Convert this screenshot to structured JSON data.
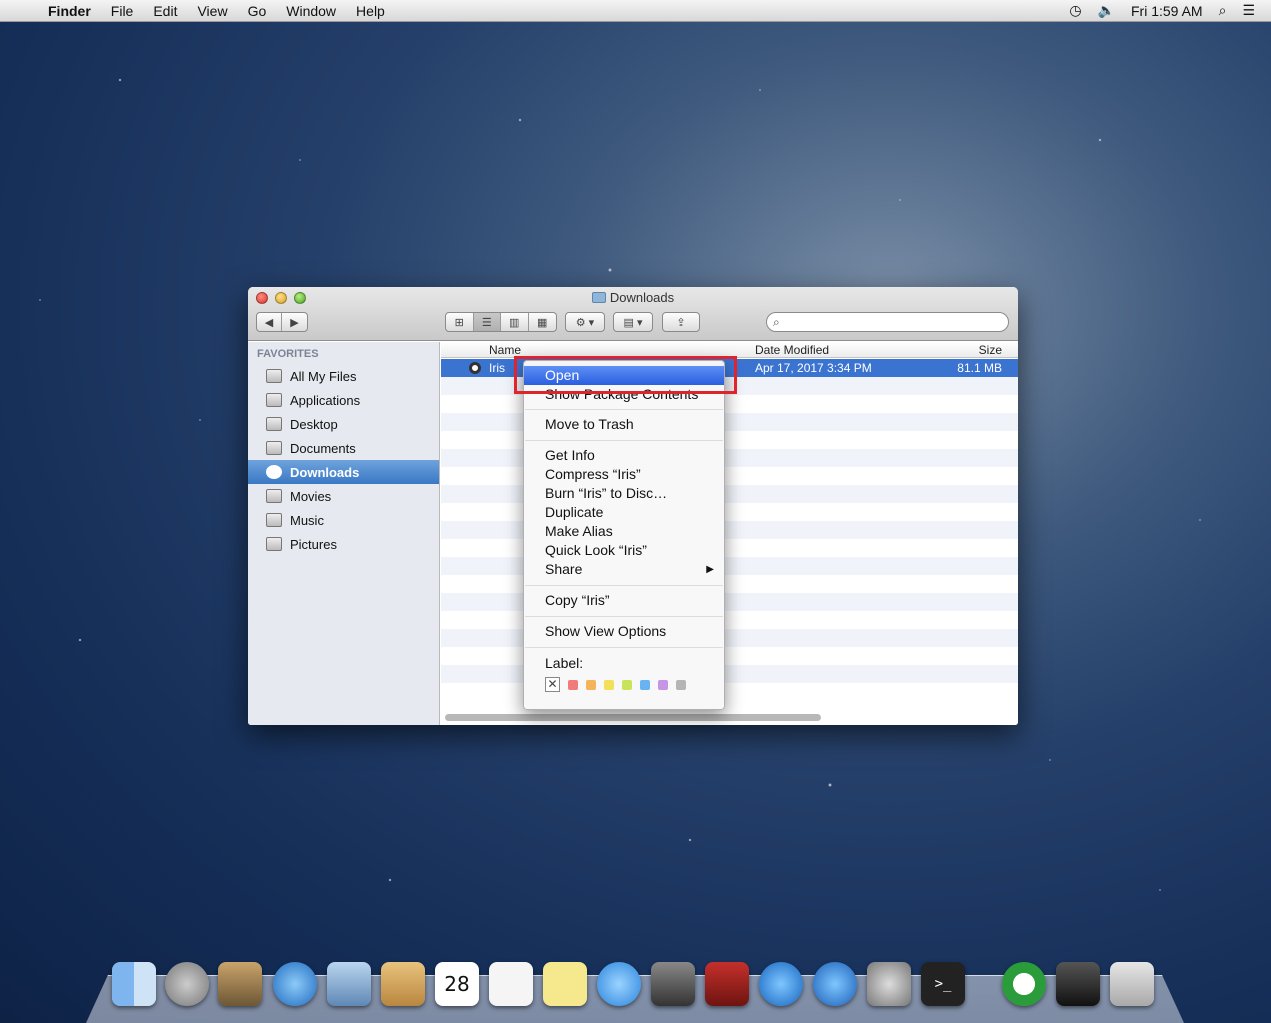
{
  "menubar": {
    "apple": "",
    "app": "Finder",
    "items": [
      "File",
      "Edit",
      "View",
      "Go",
      "Window",
      "Help"
    ],
    "clock": "Fri 1:59 AM",
    "timemachine_glyph": "◷",
    "volume_glyph": "🔈",
    "search_glyph": "⌕",
    "list_glyph": "☰"
  },
  "window": {
    "title": "Downloads",
    "nav": {
      "back": "◀",
      "forward": "▶"
    },
    "views": {
      "icon": "⊞",
      "list": "☰",
      "column": "▥",
      "coverflow": "▦"
    },
    "action_glyph": "⚙ ▾",
    "arrange_glyph": "▤ ▾",
    "share_glyph": "⇪",
    "search_glyph": "⌕",
    "sidebar": {
      "heading": "FAVORITES",
      "items": [
        "All My Files",
        "Applications",
        "Desktop",
        "Documents",
        "Downloads",
        "Movies",
        "Music",
        "Pictures"
      ]
    },
    "columns": {
      "name": "Name",
      "date": "Date Modified",
      "size": "Size"
    },
    "file": {
      "name": "Iris",
      "date": "Apr 17, 2017 3:34 PM",
      "size": "81.1 MB"
    }
  },
  "context_menu": {
    "open": "Open",
    "show_package": "Show Package Contents",
    "move_trash": "Move to Trash",
    "get_info": "Get Info",
    "compress": "Compress “Iris”",
    "burn": "Burn “Iris” to Disc…",
    "duplicate": "Duplicate",
    "make_alias": "Make Alias",
    "quick_look": "Quick Look “Iris”",
    "share": "Share",
    "share_arrow": "▶",
    "copy": "Copy “Iris”",
    "view_options": "Show View Options",
    "label": "Label:",
    "label_clear": "✕",
    "label_colors": [
      "#f07b7b",
      "#f5b35c",
      "#f3e05a",
      "#c9e35c",
      "#6ab3f2",
      "#c795e6",
      "#b5b5b5"
    ]
  },
  "dock": {
    "calendar_day": "28",
    "terminal_prompt": ">_"
  }
}
